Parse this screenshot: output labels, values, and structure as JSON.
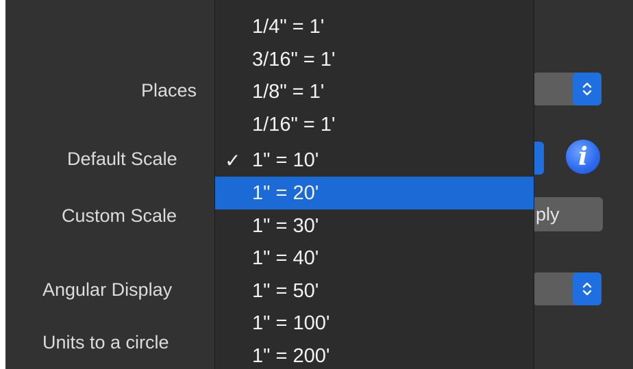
{
  "form": {
    "places_label": "Places",
    "default_scale_label": "Default Scale",
    "custom_scale_label": "Custom Scale",
    "angular_display_label": "Angular Display",
    "units_circle_label": "Units to a circle",
    "apply_label": "ply",
    "info_icon_glyph": "i"
  },
  "menu": {
    "items": [
      {
        "label": "1/4\" = 1'",
        "checked": false,
        "selected": false
      },
      {
        "label": "3/16\" = 1'",
        "checked": false,
        "selected": false
      },
      {
        "label": "1/8\" = 1'",
        "checked": false,
        "selected": false
      },
      {
        "label": "1/16\" = 1'",
        "checked": false,
        "selected": false
      },
      {
        "label": "1\" = 10'",
        "checked": true,
        "selected": false
      },
      {
        "label": "1\" = 20'",
        "checked": false,
        "selected": true
      },
      {
        "label": "1\" = 30'",
        "checked": false,
        "selected": false
      },
      {
        "label": "1\" = 40'",
        "checked": false,
        "selected": false
      },
      {
        "label": "1\" = 50'",
        "checked": false,
        "selected": false
      },
      {
        "label": "1\" = 100'",
        "checked": false,
        "selected": false
      },
      {
        "label": "1\" = 200'",
        "checked": false,
        "selected": false
      }
    ],
    "check_glyph": "✓"
  },
  "colors": {
    "accent": "#1b6ad6",
    "menu_bg": "#2c2c2c",
    "panel_bg": "#323232"
  }
}
